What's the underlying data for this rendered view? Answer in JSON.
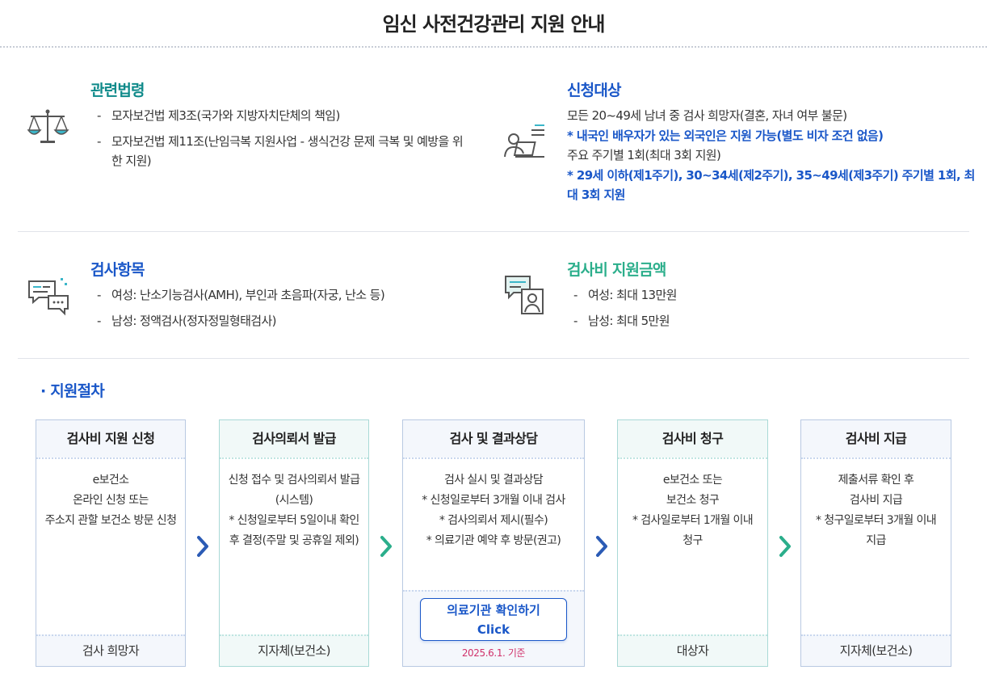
{
  "page": {
    "title": "임신 사전건강관리 지원 안내"
  },
  "colors": {
    "blue": "#1a57c8",
    "teal": "#0f8a8a",
    "green": "#2bae8b",
    "pink": "#d0326b"
  },
  "sections": {
    "law": {
      "icon": "scales-icon",
      "title": "관련법령",
      "items": [
        "모자보건법 제3조(국가와 지방자치단체의 책임)",
        "모자보건법 제11조(난임극복 지원사업 - 생식건강 문제 극복 및 예방을 위한 지원)"
      ]
    },
    "eligibility": {
      "icon": "applicant-icon",
      "title": "신청대상",
      "line1": "모든 20~49세 남녀 중 검사 희망자(결혼, 자녀 여부 불문)",
      "line2": "* 내국인 배우자가 있는 외국인은 지원 가능(별도 비자 조건 없음)",
      "line3": "주요 주기별 1회(최대 3회 지원)",
      "line4": "* 29세 이하(제1주기), 30~34세(제2주기), 35~49세(제3주기) 주기별 1회, 최대 3회 지원"
    },
    "tests": {
      "icon": "chat-bubbles-icon",
      "title": "검사항목",
      "items": [
        "여성: 난소기능검사(AMH), 부인과 초음파(자궁, 난소 등)",
        "남성: 정액검사(정자정밀형태검사)"
      ]
    },
    "amount": {
      "icon": "consultation-icon",
      "title": "검사비 지원금액",
      "items": [
        "여성: 최대 13만원",
        "남성: 최대 5만원"
      ]
    }
  },
  "procedure": {
    "title": "· 지원절차",
    "steps": [
      {
        "title": "검사비 지원 신청",
        "lines": [
          "e보건소",
          "온라인 신청 또는",
          "주소지 관할 보건소 방문 신청"
        ],
        "footer": "검사 희망자"
      },
      {
        "title": "검사의뢰서 발급",
        "lines": [
          "신청 접수 및 검사의뢰서 발급",
          "(시스템)",
          "* 신청일로부터 5일이내 확인",
          "후 결정(주말 및 공휴일 제외)"
        ],
        "footer": "지자체(보건소)"
      },
      {
        "title": "검사 및 결과상담",
        "lines": [
          "검사 실시 및 결과상담",
          "* 신청일로부터 3개월 이내 검사",
          "* 검사의뢰서 제시(필수)",
          "* 의료기관 예약 후 방문(권고)"
        ],
        "button_line1": "의료기관 확인하기",
        "button_line2": "Click",
        "note": "2025.6.1. 기준"
      },
      {
        "title": "검사비 청구",
        "lines": [
          "e보건소 또는",
          "보건소 청구",
          "* 검사일로부터 1개월 이내",
          "청구"
        ],
        "footer": "대상자"
      },
      {
        "title": "검사비 지급",
        "lines": [
          "제출서류 확인 후",
          "검사비 지급",
          "* 청구일로부터 3개월 이내",
          "지급"
        ],
        "footer": "지자체(보건소)"
      }
    ],
    "arrow_icons": [
      "chevron-right-icon",
      "chevron-right-icon",
      "chevron-right-icon",
      "chevron-right-icon"
    ]
  }
}
